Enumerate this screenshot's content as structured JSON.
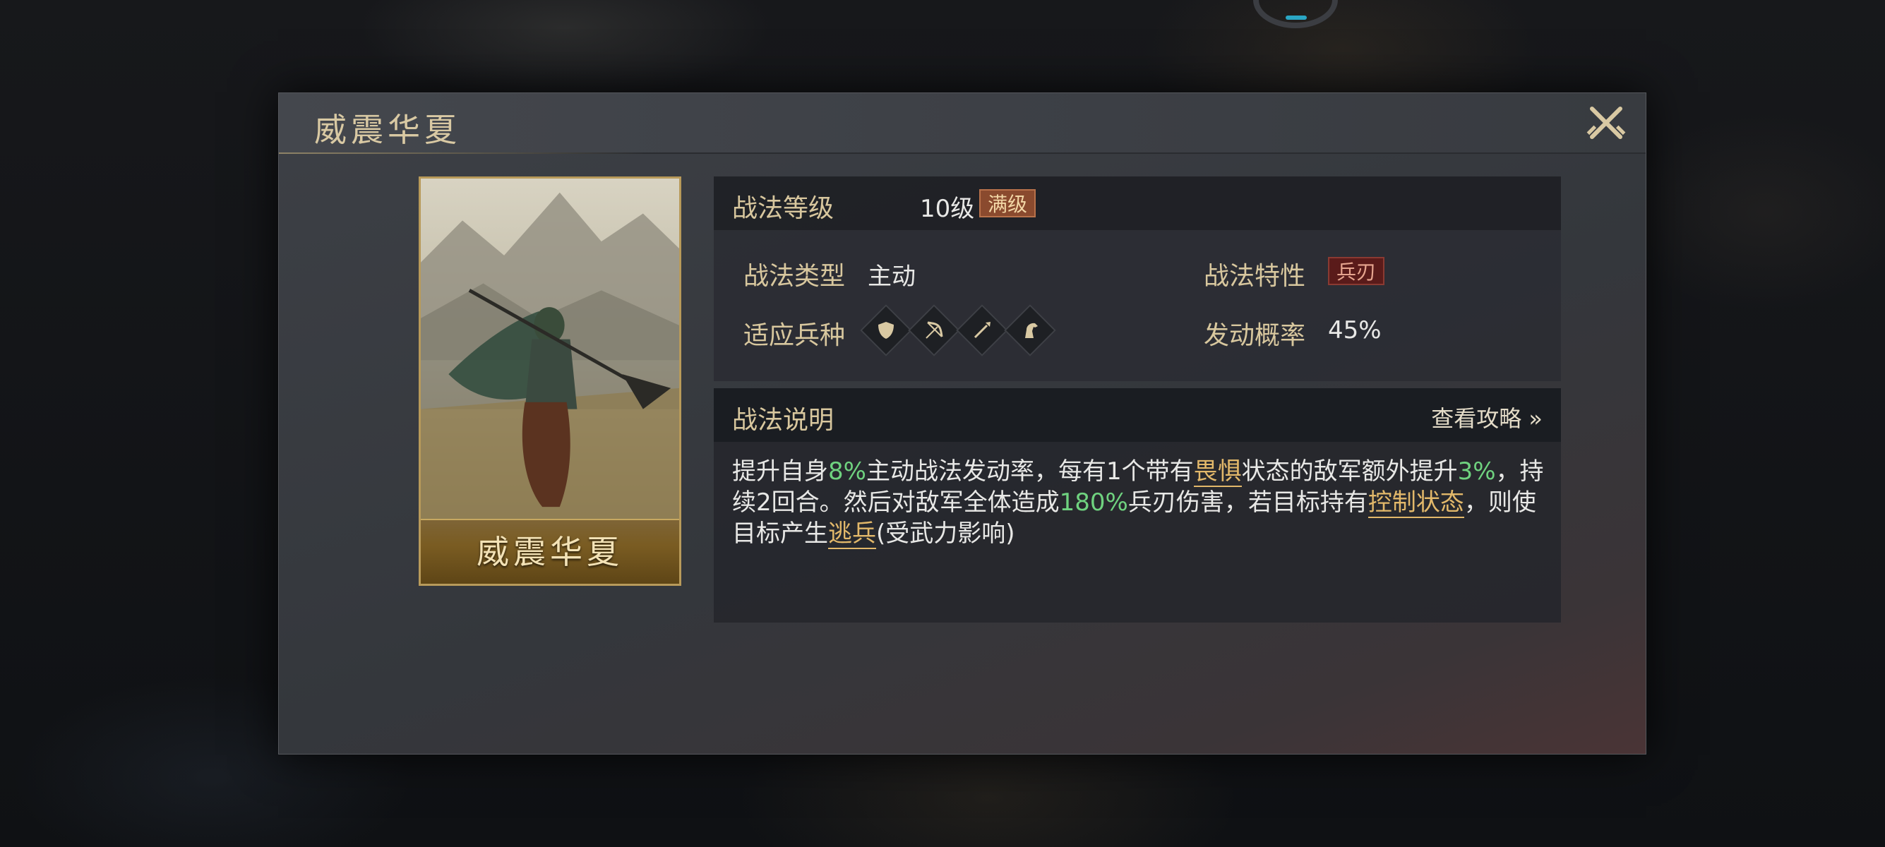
{
  "panel": {
    "title": "威震华夏"
  },
  "card": {
    "name": "威震华夏"
  },
  "info": {
    "level_label": "战法等级",
    "level_value": "10级",
    "level_badge": "满级",
    "type_label": "战法类型",
    "type_value": "主动",
    "trait_label": "战法特性",
    "trait_badge": "兵刃",
    "troops_label": "适应兵种",
    "troop_icons": [
      "shield-troop-icon",
      "bow-troop-icon",
      "spear-troop-icon",
      "horse-troop-icon"
    ],
    "rate_label": "发动概率",
    "rate_value": "45%"
  },
  "description": {
    "header": "战法说明",
    "guide_link": "查看攻略 »",
    "segments": [
      {
        "text": "提升自身",
        "style": "normal"
      },
      {
        "text": "8%",
        "style": "green"
      },
      {
        "text": "主动战法发动率，每有1个带有",
        "style": "normal"
      },
      {
        "text": "畏惧",
        "style": "gold"
      },
      {
        "text": "状态的敌军额外提升",
        "style": "normal"
      },
      {
        "text": "3%",
        "style": "green"
      },
      {
        "text": "，持续2回合。然后对敌军全体造成",
        "style": "normal"
      },
      {
        "text": "180%",
        "style": "green"
      },
      {
        "text": "兵刃伤害，若目标持有",
        "style": "normal"
      },
      {
        "text": "控制状态",
        "style": "gold"
      },
      {
        "text": "，则使目标产生",
        "style": "normal"
      },
      {
        "text": "逃兵",
        "style": "gold"
      },
      {
        "text": "(受武力影响)",
        "style": "normal"
      }
    ]
  },
  "colors": {
    "accent_gold": "#d8c79e",
    "highlight_green": "#6fd27f",
    "highlight_gold": "#e2b86a",
    "badge_full": "#8a4a2e",
    "badge_trait": "#5a1b1a"
  }
}
